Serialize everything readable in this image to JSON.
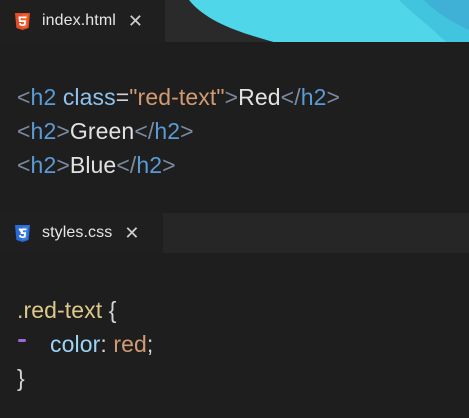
{
  "tabs": {
    "html_tab": {
      "label": "index.html",
      "close": "✕",
      "icon": "html5-icon",
      "color": "#e44d26"
    },
    "css_tab": {
      "label": "styles.css",
      "close": "✕",
      "icon": "css3-icon",
      "color": "#2a6bd6"
    }
  },
  "html_code": {
    "line1": {
      "open_lt": "<",
      "tag": "h2",
      "attr": " class",
      "eq": "=",
      "value": "\"red-text\"",
      "gt": ">",
      "text": "Red",
      "close_lt": "</",
      "close_tag": "h2",
      "close_gt": ">"
    },
    "line2": {
      "open_lt": "<",
      "tag": "h2",
      "gt": ">",
      "text": "Green",
      "close_lt": "</",
      "close_tag": "h2",
      "close_gt": ">"
    },
    "line3": {
      "open_lt": "<",
      "tag": "h2",
      "gt": ">",
      "text": "Blue",
      "close_lt": "</",
      "close_tag": "h2",
      "close_gt": ">"
    }
  },
  "css_code": {
    "line1": {
      "selector": ".red-text",
      "brace": " {"
    },
    "line2": {
      "property": "color",
      "colon": ": ",
      "value": "red",
      "semi": ";"
    },
    "line3": {
      "brace": "}"
    }
  },
  "colors": {
    "background": "#1e1e1e",
    "swoosh": "#4fd6e8"
  }
}
